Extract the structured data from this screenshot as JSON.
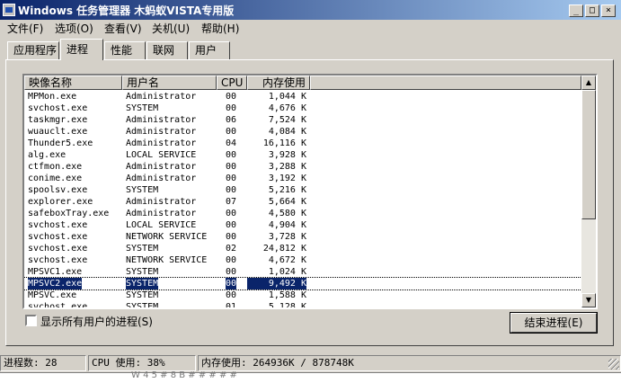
{
  "window": {
    "title": "Windows 任务管理器   木蚂蚁VISTA专用版",
    "controls": [
      "_",
      "□",
      "×"
    ]
  },
  "menu": [
    {
      "label": "文件(F)"
    },
    {
      "label": "选项(O)"
    },
    {
      "label": "查看(V)"
    },
    {
      "label": "关机(U)"
    },
    {
      "label": "帮助(H)"
    }
  ],
  "tabs": [
    {
      "label": "应用程序"
    },
    {
      "label": "进程",
      "active": true
    },
    {
      "label": "性能"
    },
    {
      "label": "联网"
    },
    {
      "label": "用户"
    }
  ],
  "table": {
    "headers": {
      "name": "映像名称",
      "user": "用户名",
      "cpu": "CPU",
      "mem": "内存使用"
    },
    "rows": [
      {
        "name": "MPMon.exe",
        "user": "Administrator",
        "cpu": "00",
        "mem": "1,044 K"
      },
      {
        "name": "svchost.exe",
        "user": "SYSTEM",
        "cpu": "00",
        "mem": "4,676 K"
      },
      {
        "name": "taskmgr.exe",
        "user": "Administrator",
        "cpu": "06",
        "mem": "7,524 K"
      },
      {
        "name": "wuauclt.exe",
        "user": "Administrator",
        "cpu": "00",
        "mem": "4,084 K"
      },
      {
        "name": "Thunder5.exe",
        "user": "Administrator",
        "cpu": "04",
        "mem": "16,116 K"
      },
      {
        "name": "alg.exe",
        "user": "LOCAL SERVICE",
        "cpu": "00",
        "mem": "3,928 K"
      },
      {
        "name": "ctfmon.exe",
        "user": "Administrator",
        "cpu": "00",
        "mem": "3,288 K"
      },
      {
        "name": "conime.exe",
        "user": "Administrator",
        "cpu": "00",
        "mem": "3,192 K"
      },
      {
        "name": "spoolsv.exe",
        "user": "SYSTEM",
        "cpu": "00",
        "mem": "5,216 K"
      },
      {
        "name": "explorer.exe",
        "user": "Administrator",
        "cpu": "07",
        "mem": "5,664 K"
      },
      {
        "name": "safeboxTray.exe",
        "user": "Administrator",
        "cpu": "00",
        "mem": "4,580 K"
      },
      {
        "name": "svchost.exe",
        "user": "LOCAL SERVICE",
        "cpu": "00",
        "mem": "4,904 K"
      },
      {
        "name": "svchost.exe",
        "user": "NETWORK SERVICE",
        "cpu": "00",
        "mem": "3,728 K"
      },
      {
        "name": "svchost.exe",
        "user": "SYSTEM",
        "cpu": "02",
        "mem": "24,812 K"
      },
      {
        "name": "svchost.exe",
        "user": "NETWORK SERVICE",
        "cpu": "00",
        "mem": "4,672 K"
      },
      {
        "name": "MPSVC1.exe",
        "user": "SYSTEM",
        "cpu": "00",
        "mem": "1,024 K"
      },
      {
        "name": "MPSVC2.exe",
        "user": "SYSTEM",
        "cpu": "00",
        "mem": "9,492 K",
        "selected": true
      },
      {
        "name": "MPSVC.exe",
        "user": "SYSTEM",
        "cpu": "00",
        "mem": "1,588 K"
      },
      {
        "name": "svchost.exe",
        "user": "SYSTEM",
        "cpu": "01",
        "mem": "5,128 K"
      }
    ]
  },
  "show_all_users": {
    "label": "显示所有用户的进程(S)",
    "checked": false
  },
  "end_process_label": "结束进程(E)",
  "status": {
    "processes": "进程数: 28",
    "cpu": "CPU 使用: 38%",
    "memory": "内存使用: 264936K / 878748K"
  },
  "taskbar_text": "W 4 5 # 8 B # # # # #"
}
